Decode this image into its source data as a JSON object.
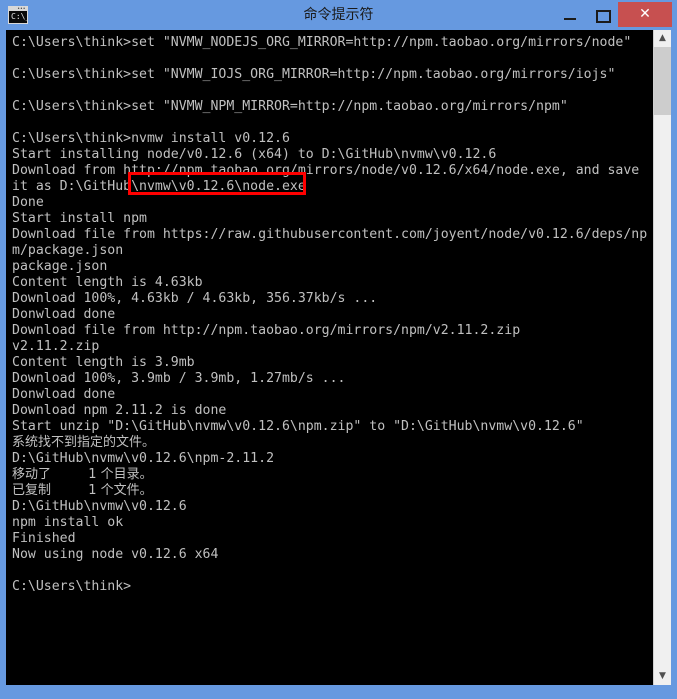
{
  "window": {
    "title": "命令提示符",
    "icon_name": "console-icon",
    "icon_text": "C:\\_",
    "colors": {
      "titlebar": "#6699e0",
      "close_button": "#c75050",
      "console_background": "#000000",
      "console_text": "#c0c0c0",
      "highlight": "#ff0000"
    },
    "controls": {
      "minimize_label": "—",
      "maximize_label": "□",
      "close_label": "✕"
    }
  },
  "scrollbar": {
    "up_arrow": "▲",
    "down_arrow": "▼",
    "thumb_position_percent": 3
  },
  "console": {
    "lines": [
      "C:\\Users\\think>set \"NVMW_NODEJS_ORG_MIRROR=http://npm.taobao.org/mirrors/node\"",
      "",
      "C:\\Users\\think>set \"NVMW_IOJS_ORG_MIRROR=http://npm.taobao.org/mirrors/iojs\"",
      "",
      "C:\\Users\\think>set \"NVMW_NPM_MIRROR=http://npm.taobao.org/mirrors/npm\"",
      "",
      "C:\\Users\\think>nvmw install v0.12.6",
      "Start installing node/v0.12.6 (x64) to D:\\GitHub\\nvmw\\v0.12.6",
      "Download from http://npm.taobao.org/mirrors/node/v0.12.6/x64/node.exe, and save",
      "it as D:\\GitHub\\nvmw\\v0.12.6\\node.exe",
      "Done",
      "Start install npm",
      "Download file from https://raw.githubusercontent.com/joyent/node/v0.12.6/deps/np",
      "m/package.json",
      "package.json",
      "Content length is 4.63kb",
      "Download 100%, 4.63kb / 4.63kb, 356.37kb/s ...",
      "Donwload done",
      "Download file from http://npm.taobao.org/mirrors/npm/v2.11.2.zip",
      "v2.11.2.zip",
      "Content length is 3.9mb",
      "Download 100%, 3.9mb / 3.9mb, 1.27mb/s ...",
      "Donwload done",
      "Download npm 2.11.2 is done",
      "Start unzip \"D:\\GitHub\\nvmw\\v0.12.6\\npm.zip\" to \"D:\\GitHub\\nvmw\\v0.12.6\"",
      "系统找不到指定的文件。",
      "D:\\GitHub\\nvmw\\v0.12.6\\npm-2.11.2",
      "移动了         1 个目录。",
      "已复制         1 个文件。",
      "D:\\GitHub\\nvmw\\v0.12.6",
      "npm install ok",
      "Finished",
      "Now using node v0.12.6 x64",
      "",
      "C:\\Users\\think>"
    ],
    "cjk_line_indices": [
      25,
      27,
      28
    ],
    "highlighted_command": "nvmw install v0.12.6"
  }
}
